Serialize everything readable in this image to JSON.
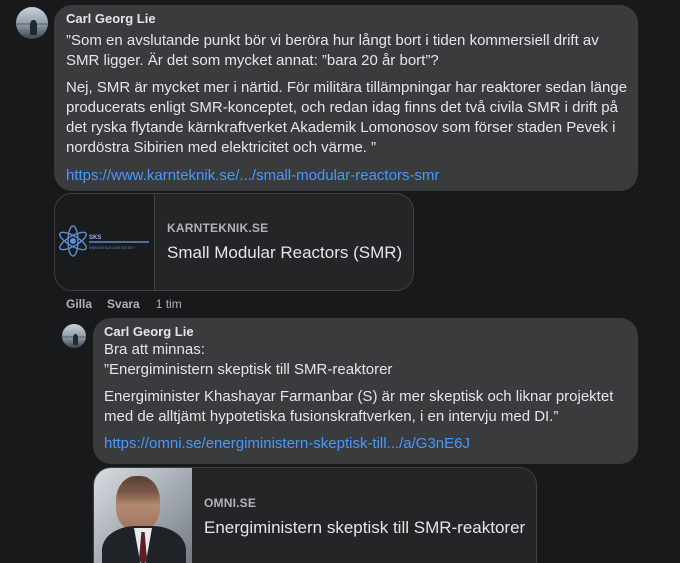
{
  "comment1": {
    "author": "Carl Georg Lie",
    "paragraph1": "”Som en avslutande punkt bör vi beröra hur långt bort i tiden kommersiell drift av\nSMR ligger. Är det som mycket annat: ”bara 20 år bort”?",
    "paragraph2": "Nej, SMR är mycket mer i närtid. För militära tillämpningar har reaktorer sedan länge\nproducerats enligt SMR-konceptet, och redan idag finns det två civila SMR i drift på\ndet ryska flytande kärnkraftverket Akademik Lomonosov som förser staden Pevek i\nnordöstra Sibirien med elektricitet och värme. ”",
    "link": "https://www.karnteknik.se/.../small-modular-reactors-smr",
    "preview": {
      "domain": "KARNTEKNIK.SE",
      "title": "Small Modular Reactors (SMR)",
      "logo_text": "SKS",
      "logo_subtext": "SWEDISH NUCLEAR SOCIETY"
    },
    "actions": {
      "like": "Gilla",
      "reply": "Svara",
      "time": "1 tim"
    }
  },
  "comment2": {
    "author": "Carl Georg Lie",
    "paragraph1": "Bra att minnas:\n”Energiministern skeptisk till SMR-reaktorer",
    "paragraph2": "Energiminister Khashayar Farmanbar (S) är mer skeptisk och liknar projektet\nmed de alltjämt hypotetiska fusionskraftverken, i en intervju med DI.”",
    "link": "https://omni.se/energiministern-skeptisk-till.../a/G3nE6J",
    "preview": {
      "domain": "OMNI.SE",
      "title": "Energiministern skeptisk till SMR-reaktorer"
    }
  },
  "colors": {
    "background": "#18191a",
    "bubble": "#3a3b3c",
    "card": "#242526",
    "link": "#4599ff",
    "secondary_text": "#b0b3b8"
  }
}
